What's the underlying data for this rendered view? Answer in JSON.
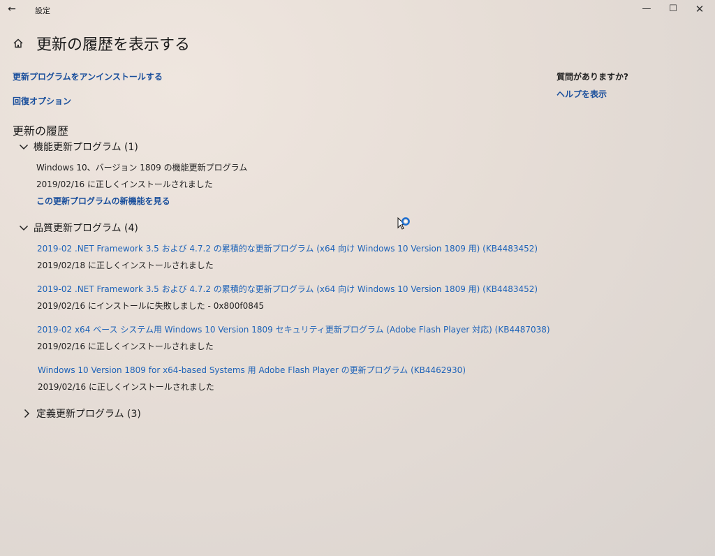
{
  "window": {
    "title": "設定",
    "back_icon": "←",
    "min_icon": "—",
    "max_icon": "☐",
    "close_icon": "✕"
  },
  "header": {
    "title": "更新の履歴を表示する"
  },
  "links": {
    "uninstall": "更新プログラムをアンインストールする",
    "recovery": "回復オプション"
  },
  "help": {
    "question": "質問がありますか?",
    "show_help": "ヘルプを表示"
  },
  "history": {
    "title": "更新の履歴",
    "feature": {
      "label": "機能更新プログラム (1)",
      "expanded": true,
      "items": [
        {
          "name": "Windows 10、バージョン 1809 の機能更新プログラム",
          "status": "2019/02/16 に正しくインストールされました",
          "link": "この更新プログラムの新機能を見る"
        }
      ]
    },
    "quality": {
      "label": "品質更新プログラム (4)",
      "expanded": true,
      "items": [
        {
          "name": "2019-02 .NET Framework 3.5 および 4.7.2 の累積的な更新プログラム (x64 向け Windows 10 Version 1809 用) (KB4483452)",
          "status": "2019/02/18 に正しくインストールされました"
        },
        {
          "name": "2019-02 .NET Framework 3.5 および 4.7.2 の累積的な更新プログラム (x64 向け Windows 10 Version 1809 用) (KB4483452)",
          "status": "2019/02/16 にインストールに失敗しました - 0x800f0845"
        },
        {
          "name": "2019-02 x64 ベース システム用 Windows 10 Version 1809 セキュリティ更新プログラム (Adobe Flash Player 対応) (KB4487038)",
          "status": "2019/02/16 に正しくインストールされました"
        },
        {
          "name": "Windows 10 Version 1809 for x64-based Systems 用 Adobe Flash Player の更新プログラム (KB4462930)",
          "status": "2019/02/16 に正しくインストールされました"
        }
      ]
    },
    "definition": {
      "label": "定義更新プログラム (3)",
      "expanded": false
    }
  },
  "colors": {
    "link": "#1a4f9c",
    "update_link": "#1e63b8",
    "text": "#1f1f1f"
  }
}
